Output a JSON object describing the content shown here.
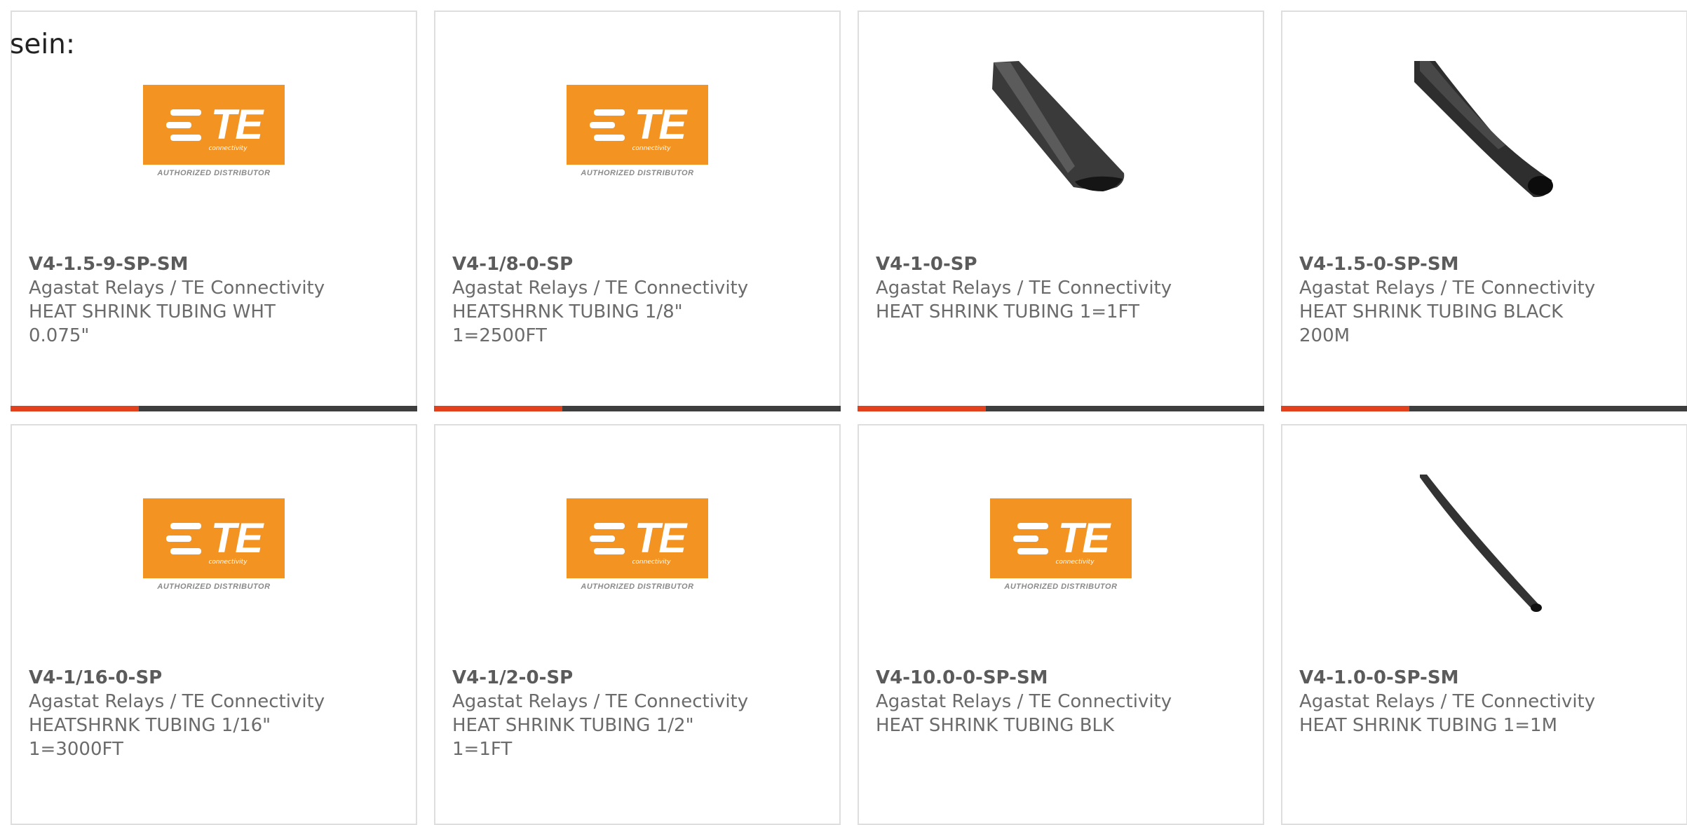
{
  "intro_text": "sein:",
  "colors": {
    "accent": "#e3401e",
    "bar": "#3e3e3e",
    "te_orange": "#f39321"
  },
  "products": [
    {
      "part": "V4-1.5-9-SP-SM",
      "brand": "Agastat Relays / TE Connectivity",
      "desc1": "HEAT SHRINK TUBING WHT",
      "desc2": "0.075\"",
      "image": "te-logo",
      "logo_word": "TE",
      "logo_sub": "connectivity",
      "logo_tag": "AUTHORIZED DISTRIBUTOR"
    },
    {
      "part": "V4-1/8-0-SP",
      "brand": "Agastat Relays / TE Connectivity",
      "desc1": "HEATSHRNK TUBING 1/8\"",
      "desc2": "1=2500FT",
      "image": "te-logo",
      "logo_word": "TE",
      "logo_sub": "connectivity",
      "logo_tag": "AUTHORIZED DISTRIBUTOR"
    },
    {
      "part": "V4-1-0-SP",
      "brand": "Agastat Relays / TE Connectivity",
      "desc1": "HEAT SHRINK TUBING 1=1FT",
      "desc2": "",
      "image": "tube-flat"
    },
    {
      "part": "V4-1.5-0-SP-SM",
      "brand": "Agastat Relays / TE Connectivity",
      "desc1": "HEAT SHRINK TUBING BLACK",
      "desc2": "200M",
      "image": "tube-round"
    },
    {
      "part": "V4-1/16-0-SP",
      "brand": "Agastat Relays / TE Connectivity",
      "desc1": "HEATSHRNK TUBING 1/16\"",
      "desc2": "1=3000FT",
      "image": "te-logo",
      "logo_word": "TE",
      "logo_sub": "connectivity",
      "logo_tag": "AUTHORIZED DISTRIBUTOR"
    },
    {
      "part": "V4-1/2-0-SP",
      "brand": "Agastat Relays / TE Connectivity",
      "desc1": "HEAT SHRINK TUBING 1/2\"",
      "desc2": "1=1FT",
      "image": "te-logo",
      "logo_word": "TE",
      "logo_sub": "connectivity",
      "logo_tag": "AUTHORIZED DISTRIBUTOR"
    },
    {
      "part": "V4-10.0-0-SP-SM",
      "brand": "Agastat Relays / TE Connectivity",
      "desc1": "HEAT SHRINK TUBING BLK",
      "desc2": "",
      "image": "te-logo",
      "logo_word": "TE",
      "logo_sub": "connectivity",
      "logo_tag": "AUTHORIZED DISTRIBUTOR"
    },
    {
      "part": "V4-1.0-0-SP-SM",
      "brand": "Agastat Relays / TE Connectivity",
      "desc1": "HEAT SHRINK TUBING 1=1M",
      "desc2": "",
      "image": "tube-thin"
    }
  ]
}
